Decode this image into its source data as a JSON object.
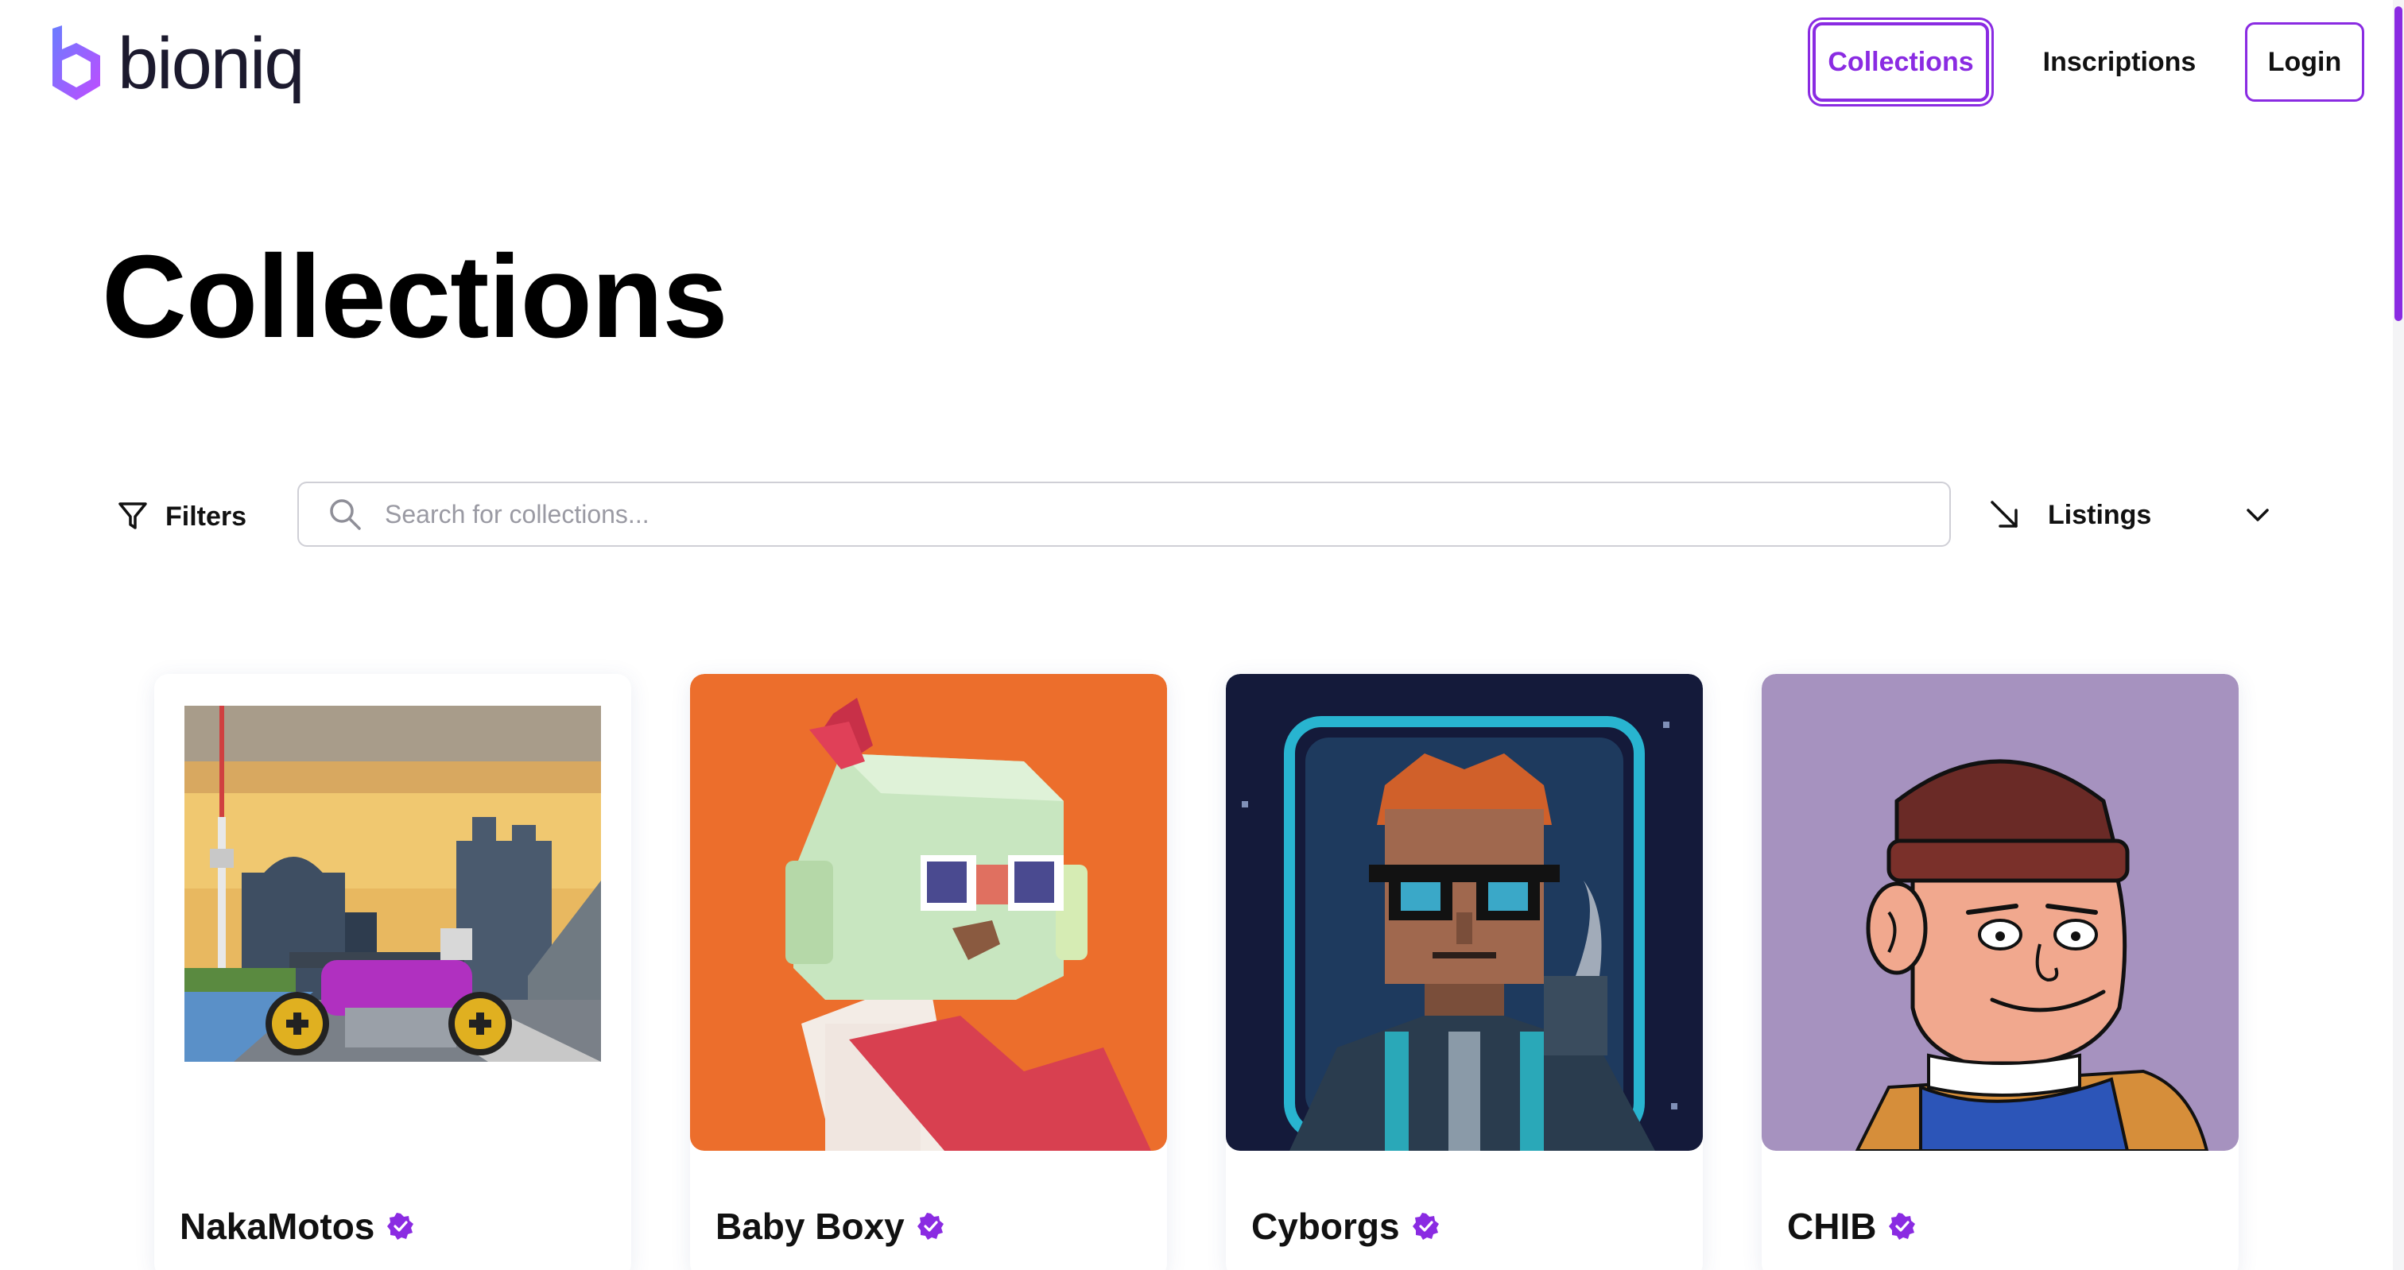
{
  "app": {
    "brand": "bioniq",
    "accent_color": "#8a2be2"
  },
  "nav": {
    "collections": "Collections",
    "inscriptions": "Inscriptions",
    "login": "Login"
  },
  "page": {
    "title": "Collections"
  },
  "toolbar": {
    "filters_label": "Filters",
    "search_placeholder": "Search for collections...",
    "search_value": "",
    "sort_label": "Listings",
    "icons": {
      "filters": "funnel-icon",
      "search": "search-icon",
      "sort": "arrow-down-right-icon",
      "dropdown": "chevron-down-icon"
    }
  },
  "collections": [
    {
      "name": "NakaMotos",
      "verified": true,
      "image": "pixel-art-motorcycle-city-image"
    },
    {
      "name": "Baby Boxy",
      "verified": true,
      "image": "boxy-character-orange-image"
    },
    {
      "name": "Cyborgs",
      "verified": true,
      "image": "pixel-cyborg-portrait-image"
    },
    {
      "name": "CHIB",
      "verified": true,
      "image": "cartoon-character-beanie-image"
    }
  ]
}
